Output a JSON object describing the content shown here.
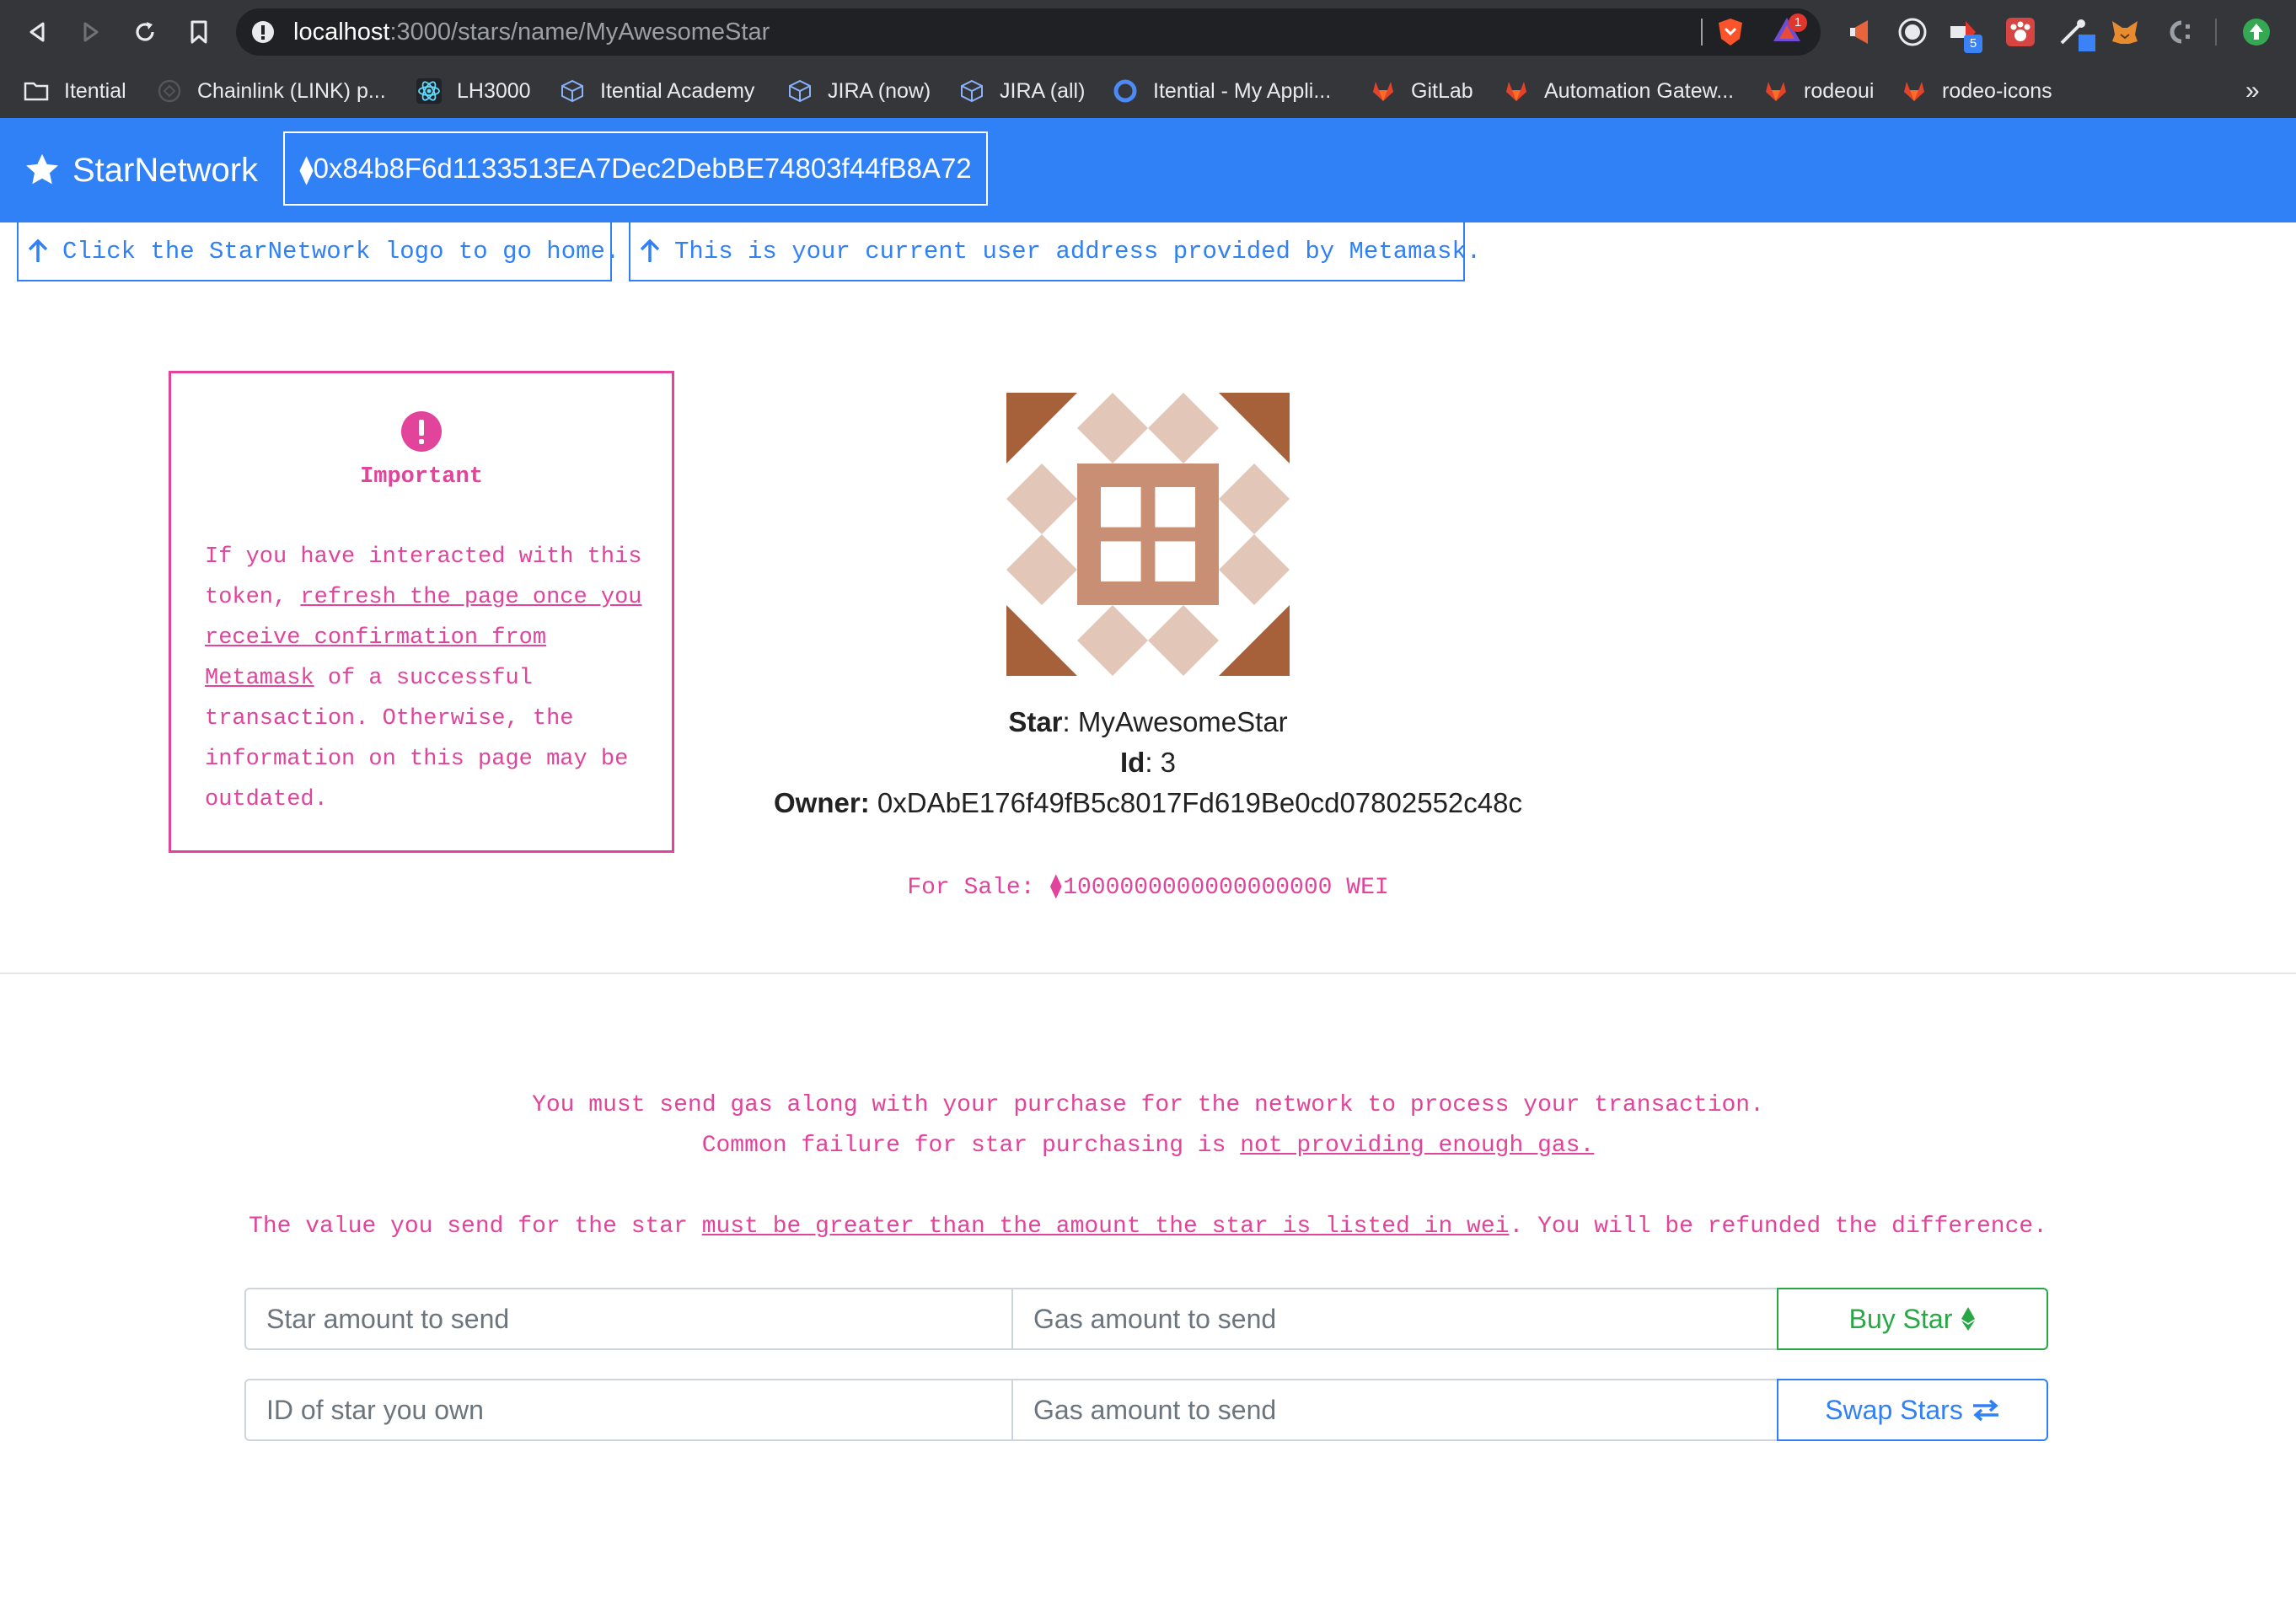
{
  "browser": {
    "url_host": "localhost",
    "url_path": ":3000/stars/name/MyAwesomeStar",
    "badge_count": "1",
    "ext_badge": "5",
    "bookmarks": [
      {
        "label": "Itential"
      },
      {
        "label": "Chainlink (LINK) p..."
      },
      {
        "label": "LH3000"
      },
      {
        "label": "Itential Academy"
      },
      {
        "label": "JIRA (now)"
      },
      {
        "label": "JIRA (all)"
      },
      {
        "label": "Itential - My Appli..."
      },
      {
        "label": "GitLab"
      },
      {
        "label": "Automation Gatew..."
      },
      {
        "label": "rodeoui"
      },
      {
        "label": "rodeo-icons"
      }
    ],
    "overflow_label": "»"
  },
  "navbar": {
    "brand": "StarNetwork",
    "eth_symbol": "⧫",
    "user_address": "0x84b8F6d1133513EA7Dec2DebBE74803f44fB8A72"
  },
  "hints": {
    "home": "Click the StarNetwork logo to go home.",
    "address": "This is your current user address provided by Metamask."
  },
  "important": {
    "title": "Important",
    "text_1": "If you have interacted with this token, ",
    "link": "refresh the page once you receive confirmation from Metamask",
    "text_2": " of a successful transaction. Otherwise, the information on this page may be outdated."
  },
  "star": {
    "name_label": "Star",
    "name": "MyAwesomeStar",
    "id_label": "Id",
    "id": "3",
    "owner_label": "Owner:",
    "owner": "0xDAbE176f49fB5c8017Fd619Be0cd07802552c48c",
    "for_sale_label": "For Sale: ",
    "eth_symbol": "⧫",
    "price": "1000000000000000000",
    "unit": " WEI"
  },
  "gas_note": {
    "line1": "You must send gas along with your purchase for the network to process your transaction.",
    "line2_text": "Common failure for star purchasing is ",
    "line2_link": "not providing enough gas."
  },
  "value_note": {
    "text_1": "The value you send for the star ",
    "link": "must be greater than the amount the star is listed in wei",
    "text_2": ". You will be refunded the difference."
  },
  "buy_form": {
    "star_amount_placeholder": "Star amount to send",
    "gas_placeholder": "Gas amount to send",
    "button_label": "Buy Star"
  },
  "swap_form": {
    "star_id_placeholder": "ID of star you own",
    "gas_placeholder": "Gas amount to send",
    "button_label": "Swap Stars"
  },
  "colors": {
    "primary": "#3181f6",
    "warning_pink": "#e2449b",
    "success_green": "#28a745",
    "identicon_dark": "#a6603a",
    "identicon_light": "#e2c7b9",
    "identicon_mid": "#c98f74"
  }
}
